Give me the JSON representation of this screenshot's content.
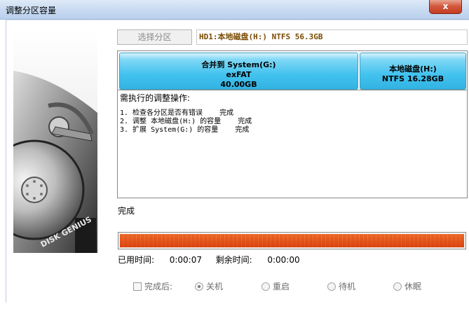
{
  "window": {
    "title": "调整分区容量",
    "close_glyph": "x"
  },
  "toolbar": {
    "select_partition_label": "选择分区",
    "disk_info": "HD1:本地磁盘(H:) NTFS 56.3GB"
  },
  "disk_map": {
    "partitions": [
      {
        "line1": "合并到 System(G:)",
        "line2": "exFAT",
        "line3": "40.00GB"
      },
      {
        "line1": "本地磁盘(H:)",
        "line2": "NTFS 16.28GB"
      }
    ]
  },
  "log": {
    "title": "需执行的调整操作:",
    "lines": [
      "1. 检查各分区是否有错误    完成",
      "2. 调整 本地磁盘(H:) 的容量    完成",
      "3. 扩展 System(G:) 的容量    完成"
    ]
  },
  "status_text": "完成",
  "progress": {
    "fraction": 1.0
  },
  "timing": {
    "elapsed_label": "已用时间:",
    "elapsed_value": "0:00:07",
    "remaining_label": "剩余时间:",
    "remaining_value": "0:00:00"
  },
  "after_completion": {
    "checkbox_label": "完成后:",
    "options": [
      {
        "label": "关机",
        "selected": true
      },
      {
        "label": "重启",
        "selected": false
      },
      {
        "label": "待机",
        "selected": false
      },
      {
        "label": "休眠",
        "selected": false
      }
    ]
  },
  "illustration": {
    "logo_text": "DISK GENIUS"
  },
  "colors": {
    "partition_fill": "#42c2ee",
    "progress_fill": "#ee8f4c",
    "title_bar": "#c7daf1",
    "close_button": "#c43b22"
  }
}
